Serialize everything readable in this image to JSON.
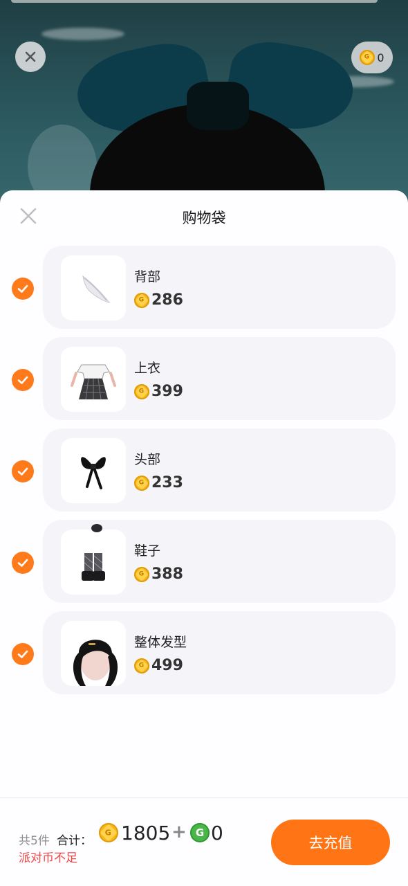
{
  "balance": {
    "amount": "0"
  },
  "sheet": {
    "title": "购物袋"
  },
  "items": [
    {
      "name": "背部",
      "price": "286",
      "icon": "wing-feather",
      "checked": true
    },
    {
      "name": "上衣",
      "price": "399",
      "icon": "dress-top",
      "checked": true
    },
    {
      "name": "头部",
      "price": "233",
      "icon": "black-bow",
      "checked": true
    },
    {
      "name": "鞋子",
      "price": "388",
      "icon": "platform-shoes",
      "checked": true
    },
    {
      "name": "整体发型",
      "price": "499",
      "icon": "twin-tail-hair",
      "checked": true
    }
  ],
  "footer": {
    "count": "共5件",
    "total_label": "合计：",
    "total_coins": "1805",
    "plus": "+",
    "total_g": "0",
    "warning": "派对币不足",
    "recharge_label": "去充值"
  },
  "colors": {
    "accent": "#ff7414",
    "check": "#ff7a1a",
    "warning": "#f04848",
    "coin": "#f6b81f",
    "g_coin": "#4bb54b"
  }
}
